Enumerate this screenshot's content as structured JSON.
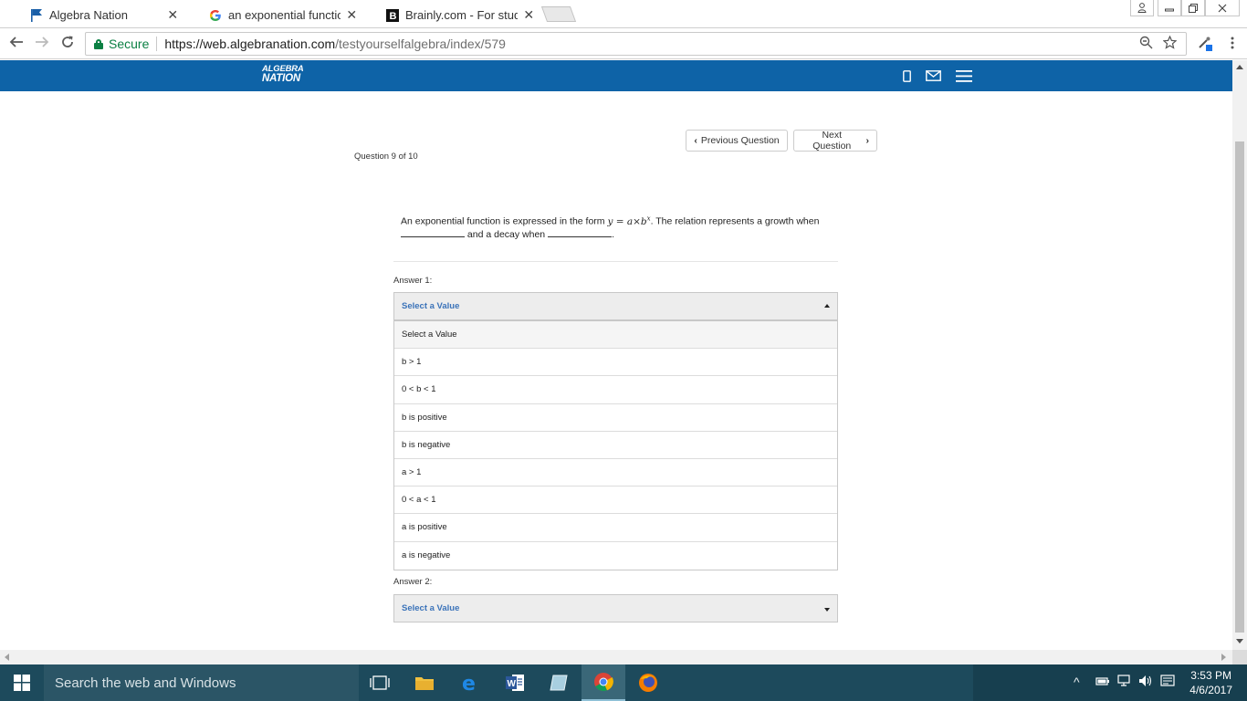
{
  "browser": {
    "tabs": [
      {
        "title": "Algebra Nation",
        "icon": "flag-icon",
        "active": true
      },
      {
        "title": "an exponential function i",
        "icon": "google-icon",
        "active": false
      },
      {
        "title": "Brainly.com - For student",
        "icon": "brainly-icon",
        "active": false
      }
    ],
    "secure_label": "Secure",
    "url_host": "https://web.algebranation.com",
    "url_path": "/testyourselfalgebra/index/579"
  },
  "header": {
    "logo_line1": "ALGEBRA",
    "logo_line2": "NATION"
  },
  "question": {
    "prev_label": "Previous Question",
    "next_label": "Next Question",
    "count": "Question 9 of 10",
    "text_before": "An exponential function is expressed in the form ",
    "math": "y = a×b",
    "math_exp": "x",
    "text_after": ". The relation represents a growth when",
    "text_line2_mid": " and a decay when ",
    "text_line2_end": "."
  },
  "answer1": {
    "label": "Answer 1:",
    "selected": "Select a Value",
    "options": [
      "Select a Value",
      "b > 1",
      "0 < b < 1",
      "b is positive",
      "b is negative",
      "a > 1",
      "0 < a < 1",
      "a is positive",
      "a is negative"
    ]
  },
  "answer2": {
    "label": "Answer 2:",
    "selected": "Select a Value"
  },
  "taskbar": {
    "search_placeholder": "Search the web and Windows",
    "time": "3:53 PM",
    "date": "4/6/2017"
  },
  "colors": {
    "header_blue": "#0e63a7",
    "link_blue": "#3b73b9",
    "secure_green": "#0b8043",
    "taskbar": "#1d4a5c"
  }
}
